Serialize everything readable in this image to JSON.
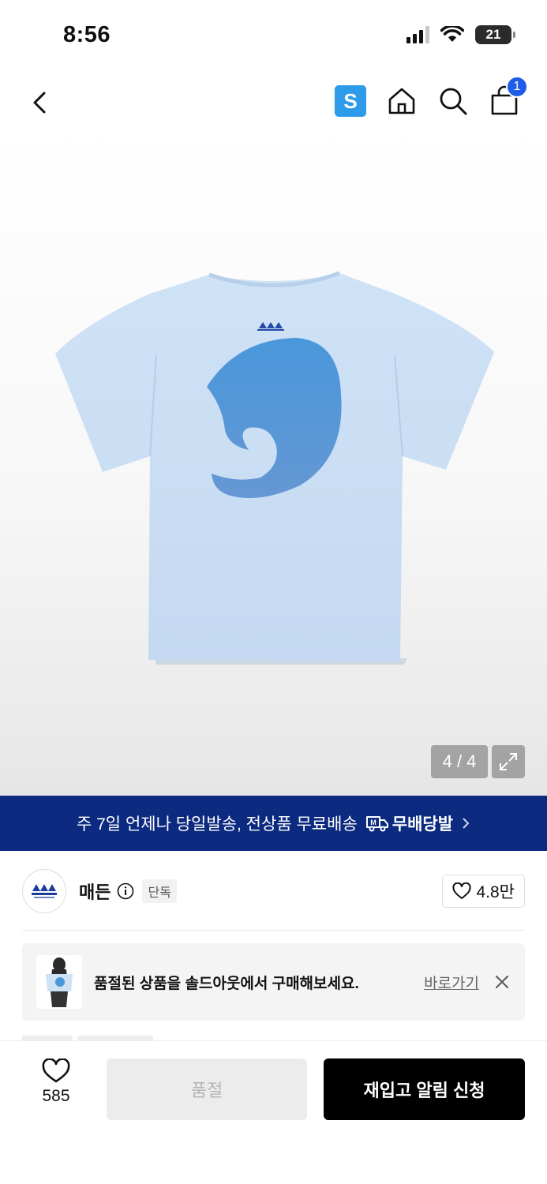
{
  "status_bar": {
    "time": "8:56",
    "battery": "21",
    "icons": [
      "signal-icon",
      "wifi-icon",
      "battery-icon"
    ]
  },
  "nav": {
    "brand_badge": "S",
    "cart_count": "1",
    "icons": [
      "back-icon",
      "home-icon",
      "search-icon",
      "cart-icon"
    ]
  },
  "gallery": {
    "counter": "4 / 4",
    "product_color": "#c5dcf3",
    "print_color": "#3d8fd6"
  },
  "promo": {
    "text": "주 7일 언제나 당일발송, 전상품 무료배송",
    "logo_label": "무배당발",
    "logo_badge": "M",
    "background": "#0b2a80"
  },
  "brand": {
    "name": "매든",
    "tag": "단독",
    "like_count": "4.8만",
    "logo_text": "MADDEN"
  },
  "soldout_notice": {
    "text": "품절된 상품을 솔드아웃에서 구매해보세요.",
    "link_label": "바로가기"
  },
  "bottom_bar": {
    "wish_count": "585",
    "soldout_label": "품절",
    "restock_label": "재입고 알림 신청"
  }
}
